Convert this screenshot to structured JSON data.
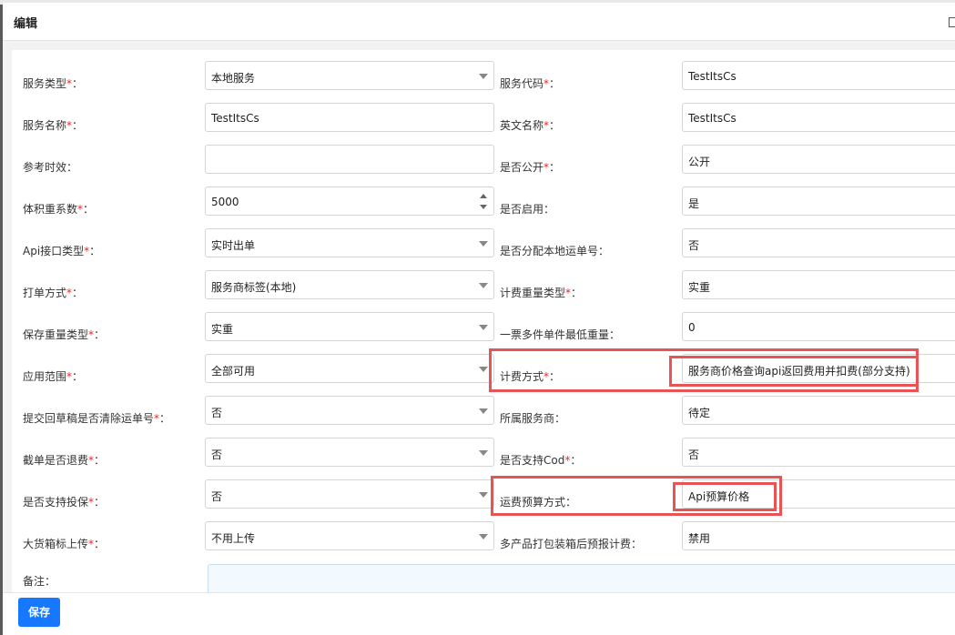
{
  "dialog": {
    "title": "编辑",
    "save_label": "保存"
  },
  "required_mark": "*",
  "colors": {
    "accent": "#1677ff",
    "required": "#e02b2b",
    "highlight": "#e85454"
  },
  "fields": {
    "service_type": {
      "label": "服务类型",
      "required": true,
      "value": "本地服务",
      "control": "select"
    },
    "service_code": {
      "label": "服务代码",
      "required": true,
      "value": "TestItsCs",
      "control": "input"
    },
    "service_name": {
      "label": "服务名称",
      "required": true,
      "value": "TestItsCs",
      "control": "input"
    },
    "english_name": {
      "label": "英文名称",
      "required": true,
      "value": "TestItsCs",
      "control": "input"
    },
    "reference_time": {
      "label": "参考时效",
      "required": false,
      "value": "",
      "control": "input"
    },
    "is_public": {
      "label": "是否公开",
      "required": true,
      "value": "公开",
      "control": "input"
    },
    "volume_factor": {
      "label": "体积重系数",
      "required": true,
      "value": "5000",
      "control": "number"
    },
    "is_enabled": {
      "label": "是否启用",
      "required": false,
      "value": "是",
      "control": "input"
    },
    "api_type": {
      "label": "Api接口类型",
      "required": true,
      "value": "实时出单",
      "control": "select"
    },
    "assign_local_no": {
      "label": "是否分配本地运单号",
      "required": false,
      "value": "否",
      "control": "input"
    },
    "print_method": {
      "label": "打单方式",
      "required": true,
      "value": "服务商标签(本地)",
      "control": "select"
    },
    "billing_weight_type": {
      "label": "计费重量类型",
      "required": true,
      "value": "实重",
      "control": "input"
    },
    "save_weight_type": {
      "label": "保存重量类型",
      "required": true,
      "value": "实重",
      "control": "select"
    },
    "multi_min_weight": {
      "label": "一票多件单件最低重量",
      "required": false,
      "value": "0",
      "control": "input"
    },
    "scope": {
      "label": "应用范围",
      "required": true,
      "value": "全部可用",
      "control": "select"
    },
    "billing_method": {
      "label": "计费方式",
      "required": true,
      "value": "服务商价格查询api返回费用并扣费(部分支持)",
      "control": "input"
    },
    "clear_no_on_submit": {
      "label": "提交回草稿是否清除运单号",
      "required": true,
      "value": "否",
      "control": "select"
    },
    "provider": {
      "label": "所属服务商",
      "required": false,
      "value": "待定",
      "control": "input"
    },
    "refund_on_cancel": {
      "label": "截单是否退费",
      "required": true,
      "value": "否",
      "control": "select"
    },
    "cod_support": {
      "label": "是否支持Cod",
      "required": true,
      "value": "否",
      "control": "input"
    },
    "insurance_support": {
      "label": "是否支持投保",
      "required": true,
      "value": "否",
      "control": "select"
    },
    "freight_estimate": {
      "label": "运费预算方式",
      "required": false,
      "value": "Api预算价格",
      "control": "input"
    },
    "big_box_upload": {
      "label": "大货箱标上传",
      "required": true,
      "value": "不用上传",
      "control": "select"
    },
    "multi_pack_billing": {
      "label": "多产品打包装箱后预报计费",
      "required": false,
      "value": "禁用",
      "control": "input"
    },
    "remark": {
      "label": "备注",
      "required": false,
      "value": ""
    }
  }
}
